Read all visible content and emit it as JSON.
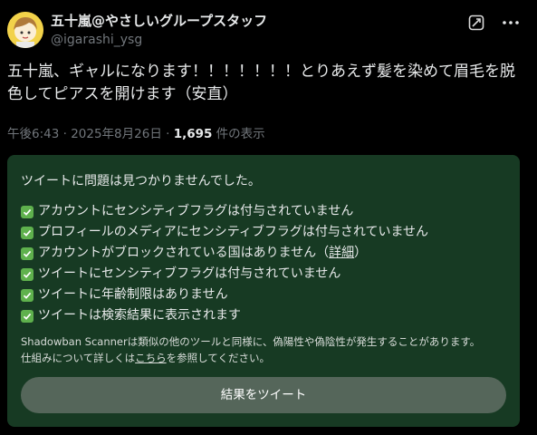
{
  "author": {
    "display_name": "五十嵐@やさしいグループスタッフ",
    "handle": "@igarashi_ysg"
  },
  "header_icons": {
    "grok": "grok-icon",
    "more": "more-icon"
  },
  "tweet": {
    "text": "五十嵐、ギャルになります！！！！！！！とりあえず髪を染めて眉毛を脱色してピアスを開けます（安直）",
    "timestamp": "午後6:43 · 2025年8月26日 · ",
    "view_count": "1,695",
    "view_suffix": " 件の表示"
  },
  "scanner": {
    "title": "ツイートに問題は見つかりませんでした。",
    "checks": [
      "アカウントにセンシティブフラグは付与されていません",
      "プロフィールのメディアにセンシティブフラグは付与されていません",
      "アカウントがブロックされている国はありません（",
      "ツイートにセンシティブフラグは付与されていません",
      "ツイートに年齢制限はありません",
      "ツイートは検索結果に表示されます"
    ],
    "detail_link": "詳細",
    "detail_close": "）",
    "disclaimer_line1": "Shadowban Scannerは類似の他のツールと同様に、偽陽性や偽陰性が発生することがあります。",
    "disclaimer_line2_prefix": "仕組みについて詳しくは",
    "disclaimer_link": "こちら",
    "disclaimer_line2_suffix": "を参照してください。",
    "button_label": "結果をツイート",
    "colors": {
      "panel_bg": "#173a23",
      "check_green": "#5fb14d",
      "button_bg": "#55665a"
    }
  }
}
